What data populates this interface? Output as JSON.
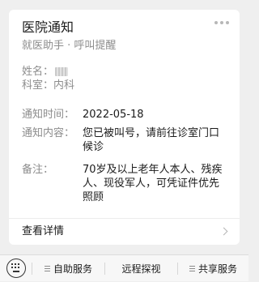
{
  "card": {
    "title": "医院通知",
    "subtitle": "就医助手 · 呼叫提醒",
    "name_label": "姓名：",
    "dept_label": "科室：",
    "dept_value": "内科",
    "rows": [
      {
        "label": "通知时间：",
        "value": "2022-05-18"
      },
      {
        "label": "通知内容：",
        "value": "您已被叫号，请前往诊室门口候诊"
      },
      {
        "label": "备注：",
        "value": "70岁及以上老年人本人、残疾人、现役军人，可凭证件优先照顾"
      }
    ],
    "details_label": "查看详情"
  },
  "bottombar": {
    "tabs": [
      "自助服务",
      "远程探视",
      "共享服务"
    ]
  }
}
